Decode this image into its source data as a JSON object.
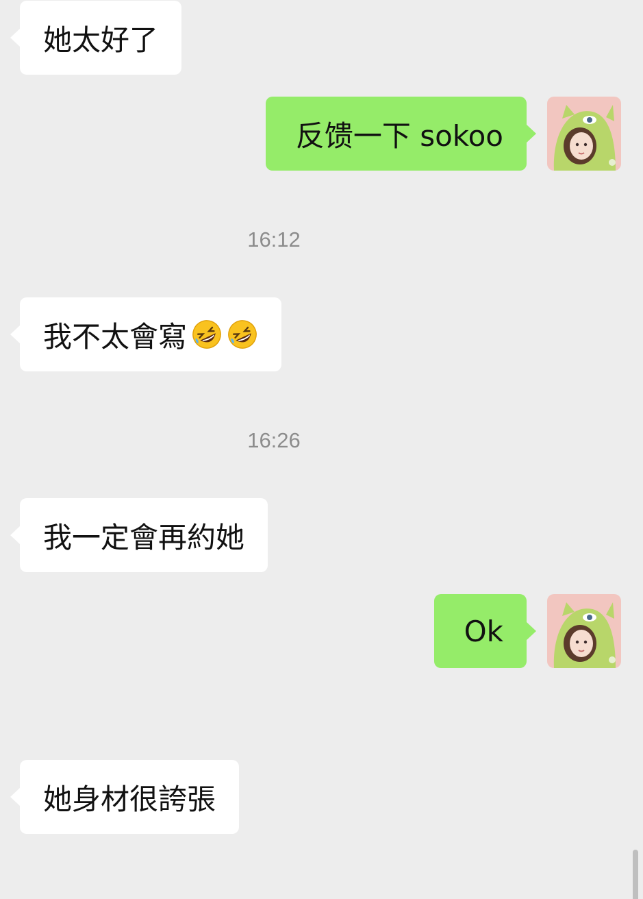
{
  "messages": {
    "m1": "她太好了",
    "m2": "反馈一下 sokoo",
    "m3_text": "我不太會寫",
    "m4": "我一定會再約她",
    "m5": "Ok",
    "m6": "她身材很誇張"
  },
  "timestamps": {
    "t1": "16:12",
    "t2": "16:26"
  },
  "icons": {
    "avatar": "girl-in-green-monster-hood-avatar",
    "emoji": "rolling-on-the-floor-laughing"
  },
  "colors": {
    "background": "#ededed",
    "incoming_bubble": "#ffffff",
    "outgoing_bubble": "#95ec69",
    "timestamp_text": "#8c8c8c"
  }
}
